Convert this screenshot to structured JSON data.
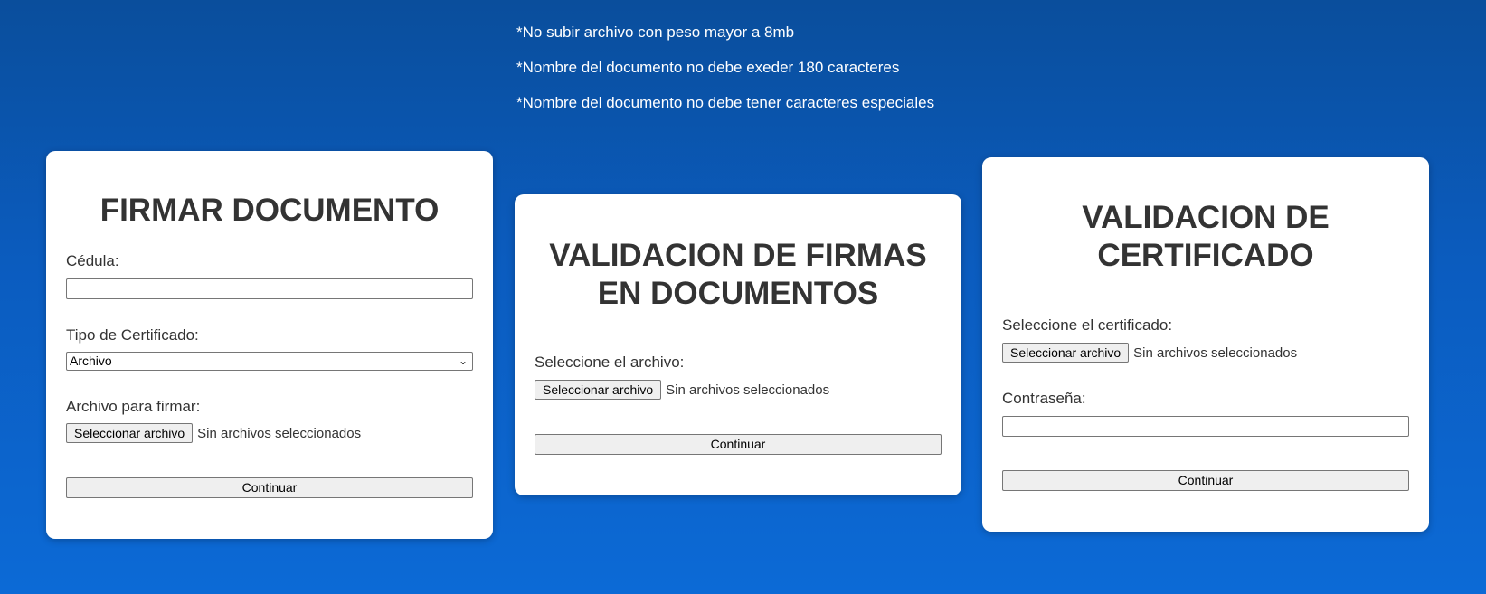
{
  "notes": [
    "*No subir archivo con peso mayor a 8mb",
    "*Nombre del documento no debe exeder 180 caracteres",
    "*Nombre del documento no debe tener caracteres especiales"
  ],
  "firmar": {
    "title": "FIRMAR DOCUMENTO",
    "cedula_label": "Cédula:",
    "cedula_value": "",
    "tipo_label": "Tipo de Certificado:",
    "tipo_selected": "Archivo",
    "archivo_label": "Archivo para firmar:",
    "file_button": "Seleccionar archivo",
    "file_status": "Sin archivos seleccionados",
    "continuar": "Continuar"
  },
  "validacion_firmas": {
    "title_line1": "VALIDACION DE FIRMAS",
    "title_line2": "EN DOCUMENTOS",
    "archivo_label": "Seleccione el archivo:",
    "file_button": "Seleccionar archivo",
    "file_status": "Sin archivos seleccionados",
    "continuar": "Continuar"
  },
  "validacion_certificado": {
    "title_line1": "VALIDACION DE",
    "title_line2": "CERTIFICADO",
    "cert_label": "Seleccione el certificado:",
    "file_button": "Seleccionar archivo",
    "file_status": "Sin archivos seleccionados",
    "password_label": "Contraseña:",
    "password_value": "",
    "continuar": "Continuar"
  },
  "icons": {
    "select_chevron": "chevron-down-icon"
  }
}
